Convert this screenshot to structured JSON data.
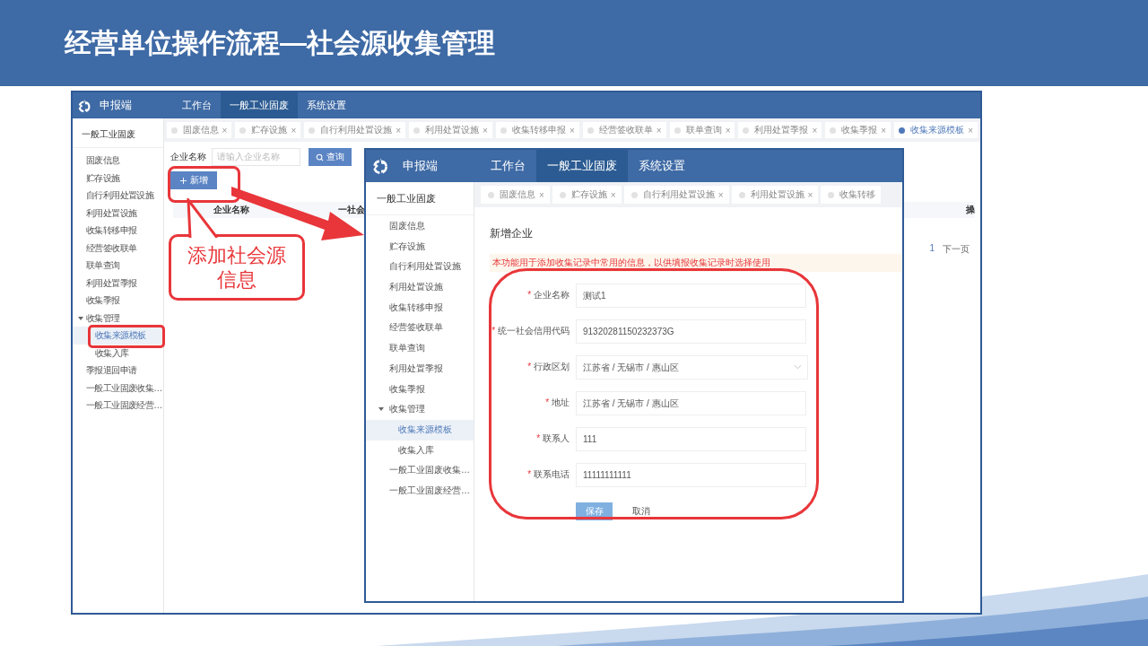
{
  "slide_title": "经营单位操作流程—社会源收集管理",
  "back_window": {
    "brand": "申报端",
    "nav": [
      {
        "label": "工作台",
        "selected": false
      },
      {
        "label": "一般工业固废",
        "selected": true
      },
      {
        "label": "系统设置",
        "selected": false
      }
    ],
    "sidebar": {
      "title": "一般工业固废",
      "items": [
        {
          "label": "固废信息",
          "selected": false
        },
        {
          "label": "贮存设施",
          "selected": false
        },
        {
          "label": "自行利用处置设施",
          "selected": false
        },
        {
          "label": "利用处置设施",
          "selected": false
        },
        {
          "label": "收集转移申报",
          "selected": false
        },
        {
          "label": "经营签收联单",
          "selected": false
        },
        {
          "label": "联单查询",
          "selected": false
        },
        {
          "label": "利用处置季报",
          "selected": false
        },
        {
          "label": "收集季报",
          "selected": false
        },
        {
          "label": "收集管理",
          "selected": false,
          "expanded": true,
          "children": [
            {
              "label": "收集来源模板",
              "selected": true
            },
            {
              "label": "收集入库",
              "selected": false
            }
          ]
        },
        {
          "label": "季报退回申请",
          "selected": false
        },
        {
          "label": "一般工业固废收集…",
          "selected": false
        },
        {
          "label": "一般工业固废经营…",
          "selected": false
        }
      ]
    },
    "tabs": [
      {
        "label": "固废信息",
        "close": "×",
        "selected": false
      },
      {
        "label": "贮存设施",
        "close": "×",
        "selected": false
      },
      {
        "label": "自行利用处置设施",
        "close": "×",
        "selected": false
      },
      {
        "label": "利用处置设施",
        "close": "×",
        "selected": false
      },
      {
        "label": "收集转移申报",
        "close": "×",
        "selected": false
      },
      {
        "label": "经营签收联单",
        "close": "×",
        "selected": false
      },
      {
        "label": "联单查询",
        "close": "×",
        "selected": false
      },
      {
        "label": "利用处置季报",
        "close": "×",
        "selected": false
      },
      {
        "label": "收集季报",
        "close": "×",
        "selected": false
      },
      {
        "label": "收集来源模板",
        "close": "×",
        "selected": true
      }
    ],
    "search": {
      "label": "企业名称",
      "placeholder": "请输入企业名称",
      "button": "查询"
    },
    "add_button": "新增",
    "table": {
      "columns": [
        "企业名称",
        "一社会",
        "操"
      ]
    },
    "pagination": {
      "page": "1",
      "next": "下一页"
    }
  },
  "front_window": {
    "brand": "申报端",
    "nav": [
      {
        "label": "工作台",
        "selected": false
      },
      {
        "label": "一般工业固废",
        "selected": true
      },
      {
        "label": "系统设置",
        "selected": false
      }
    ],
    "sidebar": {
      "title": "一般工业固废",
      "items": [
        {
          "label": "固废信息",
          "selected": false
        },
        {
          "label": "贮存设施",
          "selected": false
        },
        {
          "label": "自行利用处置设施",
          "selected": false
        },
        {
          "label": "利用处置设施",
          "selected": false
        },
        {
          "label": "收集转移申报",
          "selected": false
        },
        {
          "label": "经营签收联单",
          "selected": false
        },
        {
          "label": "联单查询",
          "selected": false
        },
        {
          "label": "利用处置季报",
          "selected": false
        },
        {
          "label": "收集季报",
          "selected": false
        },
        {
          "label": "收集管理",
          "selected": false,
          "expanded": true,
          "children": [
            {
              "label": "收集来源模板",
              "selected": true
            },
            {
              "label": "收集入库",
              "selected": false
            }
          ]
        },
        {
          "label": "一般工业固废收集…",
          "selected": false
        },
        {
          "label": "一般工业固废经营…",
          "selected": false
        }
      ]
    },
    "tabs": [
      {
        "label": "固废信息",
        "close": "×",
        "selected": false
      },
      {
        "label": "贮存设施",
        "close": "×",
        "selected": false
      },
      {
        "label": "自行利用处置设施",
        "close": "×",
        "selected": false
      },
      {
        "label": "利用处置设施",
        "close": "×",
        "selected": false
      },
      {
        "label": "收集转移",
        "selected": false
      }
    ],
    "form": {
      "title": "新增企业",
      "notice": "本功能用于添加收集记录中常用的信息，以供填报收集记录时选择使用",
      "fields": [
        {
          "label": "企业名称",
          "required_mark": "*",
          "kind": "input",
          "value": "测试1"
        },
        {
          "label": "统一社会信用代码",
          "required_mark": "*",
          "kind": "input",
          "value": "91320281150232373G"
        },
        {
          "label": "行政区划",
          "required_mark": "*",
          "kind": "select",
          "value": "江苏省 / 无锡市 / 惠山区"
        },
        {
          "label": "地址",
          "required_mark": "*",
          "kind": "input",
          "value": "江苏省 / 无锡市 / 惠山区"
        },
        {
          "label": "联系人",
          "required_mark": "*",
          "kind": "input",
          "value": "111"
        },
        {
          "label": "联系电话",
          "required_mark": "*",
          "kind": "input",
          "value": "11111111111"
        }
      ],
      "buttons": [
        {
          "label": "保存",
          "kind": "primary"
        },
        {
          "label": "取消",
          "kind": "text"
        }
      ]
    }
  },
  "callout": "添加社会源信息"
}
